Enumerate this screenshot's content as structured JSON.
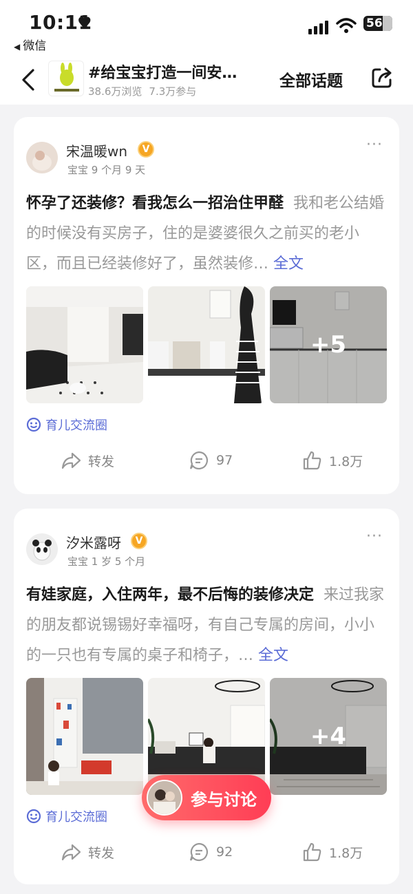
{
  "status_bar": {
    "time": "10:11",
    "back_app": "微信",
    "battery": "56"
  },
  "header": {
    "back_icon": "chevron-left-icon",
    "topic_title": "#给宝宝打造一间安…",
    "views": "38.6万浏览",
    "participants": "7.3万参与",
    "all_topics": "全部话题",
    "share_icon": "share-icon"
  },
  "posts": [
    {
      "author": "宋温暖wn",
      "verified": "V",
      "baby_age": "宝宝 9 个月 9 天",
      "title": "怀孕了还装修？看我怎么一招治住甲醛",
      "excerpt": "我和老公结婚的时候没有买房子，住的是婆婆很久之前买的老小区，而且已经装修好了，虽然装修…",
      "full_text": "全文",
      "more_images": "+5",
      "circle": "育儿交流圈",
      "forward": "转发",
      "comments": "97",
      "likes": "1.8万"
    },
    {
      "author": "汐米露呀",
      "verified": "V",
      "baby_age": "宝宝 1 岁 5 个月",
      "title": "有娃家庭，入住两年，最不后悔的装修决定",
      "excerpt": "来过我家的朋友都说锡锡好幸福呀，有自己专属的房间，小小的一只也有专属的桌子和椅子，…",
      "full_text": "全文",
      "more_images": "+4",
      "circle": "育儿交流圈",
      "forward": "转发",
      "comments": "92",
      "likes": "1.8万"
    }
  ],
  "fab": {
    "label": "参与讨论"
  },
  "colors": {
    "accent": "#5b6cd6",
    "fab": "#ff3d55",
    "badge": "#f6a623"
  }
}
